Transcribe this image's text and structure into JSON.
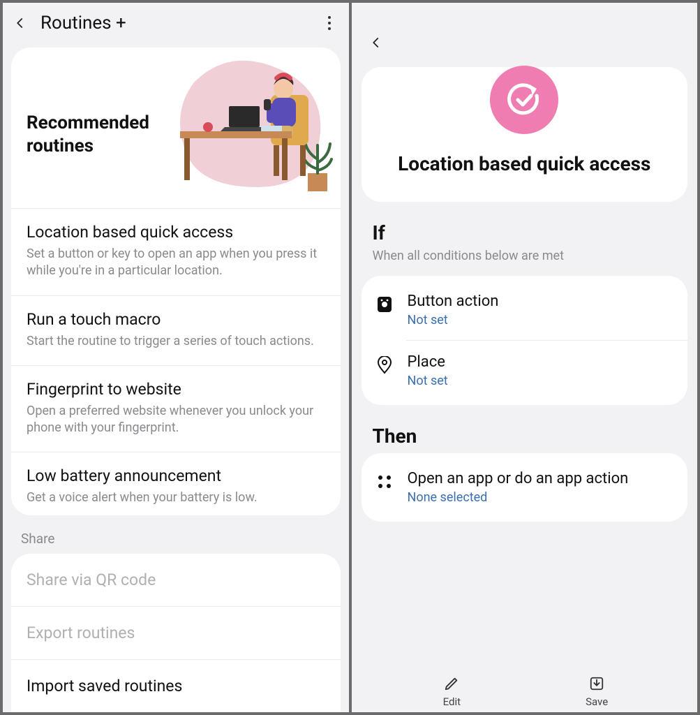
{
  "left": {
    "title": "Routines +",
    "recommended_heading": "Recommended routines",
    "routines": [
      {
        "name": "Location based quick access",
        "desc": "Set a button or key to open an app when you press it while you're in a particular location."
      },
      {
        "name": "Run a touch macro",
        "desc": "Start the routine to trigger a series of touch actions."
      },
      {
        "name": "Fingerprint to website",
        "desc": "Open a preferred website whenever you unlock your phone with your fingerprint."
      },
      {
        "name": "Low battery announcement",
        "desc": "Get a voice alert when your battery is low."
      }
    ],
    "share_label": "Share",
    "share_items": [
      {
        "label": "Share via QR code",
        "active": false
      },
      {
        "label": "Export routines",
        "active": false
      },
      {
        "label": "Import saved routines",
        "active": true
      }
    ]
  },
  "right": {
    "hero_title": "Location based quick access",
    "if_label": "If",
    "if_sub": "When all conditions below are met",
    "conditions": [
      {
        "icon": "button",
        "title": "Button action",
        "value": "Not set"
      },
      {
        "icon": "place",
        "title": "Place",
        "value": "Not set"
      }
    ],
    "then_label": "Then",
    "actions": [
      {
        "icon": "apps",
        "title": "Open an app or do an app action",
        "value": "None selected"
      }
    ],
    "bottom": {
      "edit": "Edit",
      "save": "Save"
    }
  },
  "colors": {
    "accent_pink": "#f07db1",
    "link_blue": "#3a6fb0"
  }
}
